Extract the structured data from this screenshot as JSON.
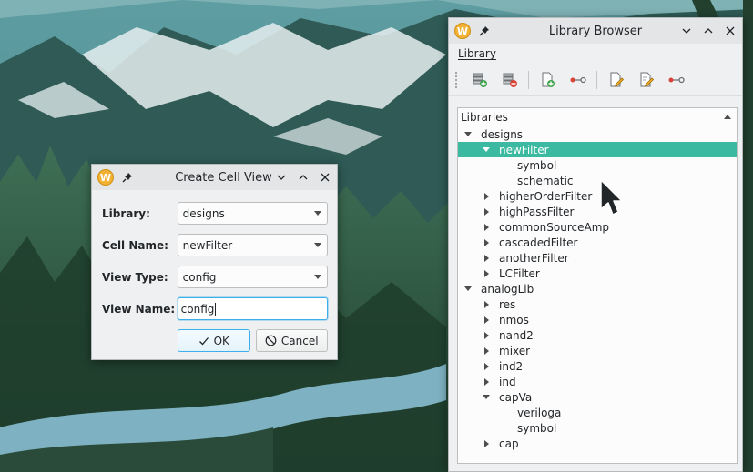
{
  "create_dialog": {
    "title": "Create Cell View",
    "app_icon": "W",
    "fields": {
      "library": {
        "label": "Library:",
        "value": "designs"
      },
      "cell_name": {
        "label": "Cell Name:",
        "value": "newFilter"
      },
      "view_type": {
        "label": "View Type:",
        "value": "config"
      },
      "view_name": {
        "label": "View Name:",
        "value": "config"
      }
    },
    "ok_label": "OK",
    "cancel_label": "Cancel"
  },
  "library_browser": {
    "title": "Library Browser",
    "app_icon": "W",
    "menu": [
      "Library"
    ],
    "toolbar_icons": [
      "new-library-icon",
      "remove-library-icon",
      "new-cell-icon",
      "add-connection-icon",
      "edit-document-icon",
      "edit-note-icon",
      "add-connection-icon"
    ],
    "tree_header": "Libraries",
    "tree": {
      "designs": "designs",
      "newFilter": "newFilter",
      "newFilter_symbol": "symbol",
      "newFilter_schematic": "schematic",
      "higherOrderFilter": "higherOrderFilter",
      "highPassFilter": "highPassFilter",
      "commonSourceAmp": "commonSourceAmp",
      "cascadedFilter": "cascadedFilter",
      "anotherFilter": "anotherFilter",
      "LCFilter": "LCFilter",
      "analogLib": "analogLib",
      "res": "res",
      "nmos": "nmos",
      "nand2": "nand2",
      "mixer": "mixer",
      "ind2": "ind2",
      "ind": "ind",
      "capVa": "capVa",
      "capVa_veriloga": "veriloga",
      "capVa_symbol": "symbol",
      "cap": "cap"
    },
    "selected_item": "newFilter"
  },
  "colors": {
    "selection": "#3cbaa1",
    "focus": "#3daee9",
    "window_bg": "#eff0f1"
  }
}
